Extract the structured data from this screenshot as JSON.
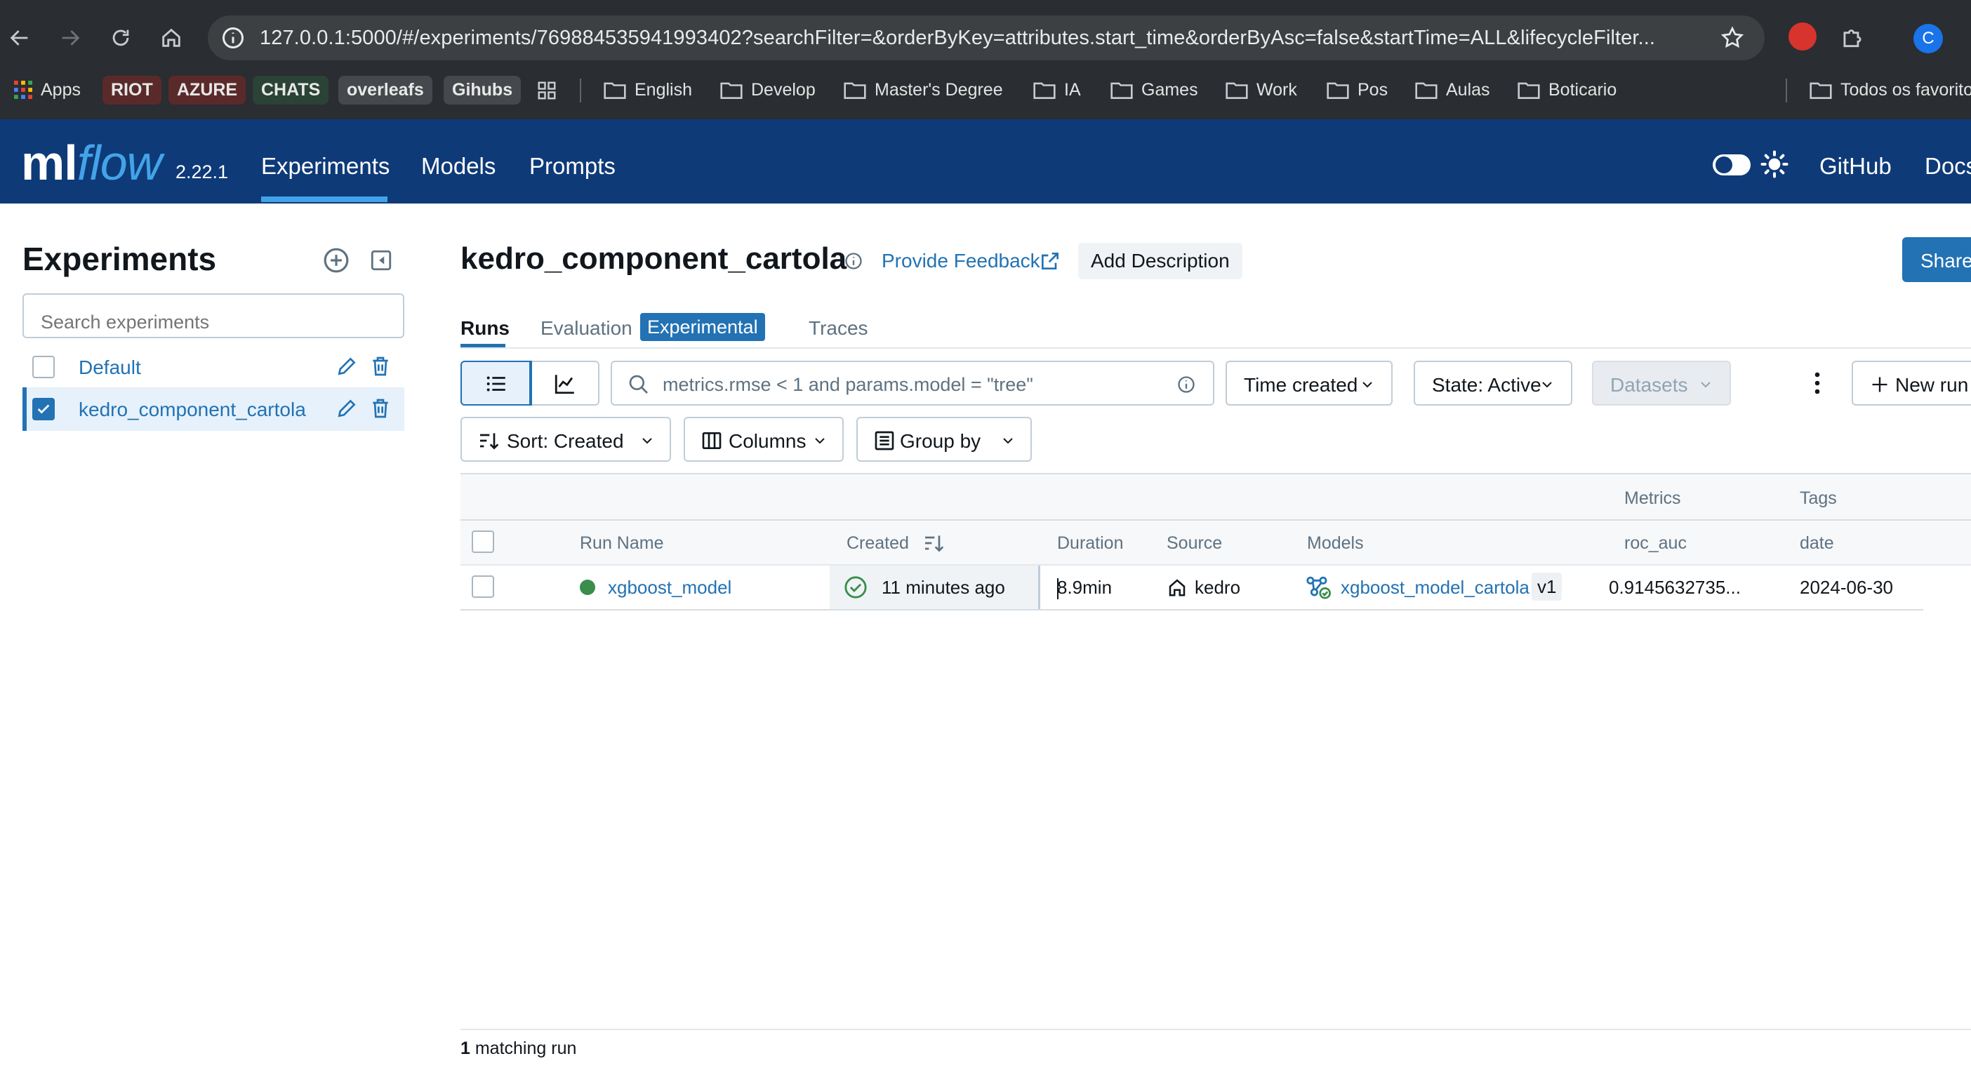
{
  "browser": {
    "url": "127.0.0.1:5000/#/experiments/769884535941993402?searchFilter=&orderByKey=attributes.start_time&orderByAsc=false&startTime=ALL&lifecycleFilter...",
    "avatar_letter": "C",
    "bookmarks": [
      {
        "label": "Apps"
      },
      {
        "label": "RIOT",
        "bg": "#6b2b2b"
      },
      {
        "label": "AZURE",
        "bg": "#6b2b2b"
      },
      {
        "label": "CHATS",
        "bg": "#2c4a3a"
      },
      {
        "label": "overleafs",
        "bg": "#4a4a4a"
      },
      {
        "label": "Gihubs",
        "bg": "#4a4a4a"
      },
      {
        "label": "English"
      },
      {
        "label": "Develop"
      },
      {
        "label": "Master's Degree"
      },
      {
        "label": "IA"
      },
      {
        "label": "Games"
      },
      {
        "label": "Work"
      },
      {
        "label": "Pos"
      },
      {
        "label": "Aulas"
      },
      {
        "label": "Boticario"
      },
      {
        "label": "Todos os favoritos"
      }
    ]
  },
  "header": {
    "logo_ml": "ml",
    "logo_flow": "flow",
    "version": "2.22.1",
    "nav": [
      "Experiments",
      "Models",
      "Prompts"
    ],
    "links": [
      "GitHub",
      "Docs"
    ],
    "colors": {
      "bar": "#0e3a78",
      "accent": "#43a3e8"
    }
  },
  "sidebar": {
    "title": "Experiments",
    "search_placeholder": "Search experiments",
    "experiments": [
      {
        "name": "Default",
        "checked": false
      },
      {
        "name": "kedro_component_cartola",
        "checked": true
      }
    ]
  },
  "main": {
    "experiment_title": "kedro_component_cartola",
    "feedback": "Provide Feedback",
    "add_description": "Add Description",
    "share": "Share",
    "tabs": [
      {
        "label": "Runs",
        "active": true
      },
      {
        "label": "Evaluation",
        "badge": "Experimental"
      },
      {
        "label": "Traces"
      }
    ],
    "search_query": "metrics.rmse < 1 and params.model = \"tree\"",
    "time_filter": "Time created",
    "state_filter": "State: Active",
    "datasets_filter": "Datasets",
    "new_run": "New run",
    "sort": "Sort: Created",
    "columns": "Columns",
    "group_by": "Group by"
  },
  "table": {
    "group_headers": {
      "metrics": "Metrics",
      "tags": "Tags"
    },
    "columns": [
      "Run Name",
      "Created",
      "Duration",
      "Source",
      "Models",
      "roc_auc",
      "date"
    ],
    "rows": [
      {
        "run_name": "xgboost_model",
        "created": "11 minutes ago",
        "duration": "8.9min",
        "source": "kedro",
        "model": "xgboost_model_cartola",
        "model_version": "v1",
        "roc_auc": "0.9145632735...",
        "date": "2024-06-30",
        "status_color": "#3a8d4a"
      }
    ],
    "footer_count": "1",
    "footer_text": " matching run"
  }
}
